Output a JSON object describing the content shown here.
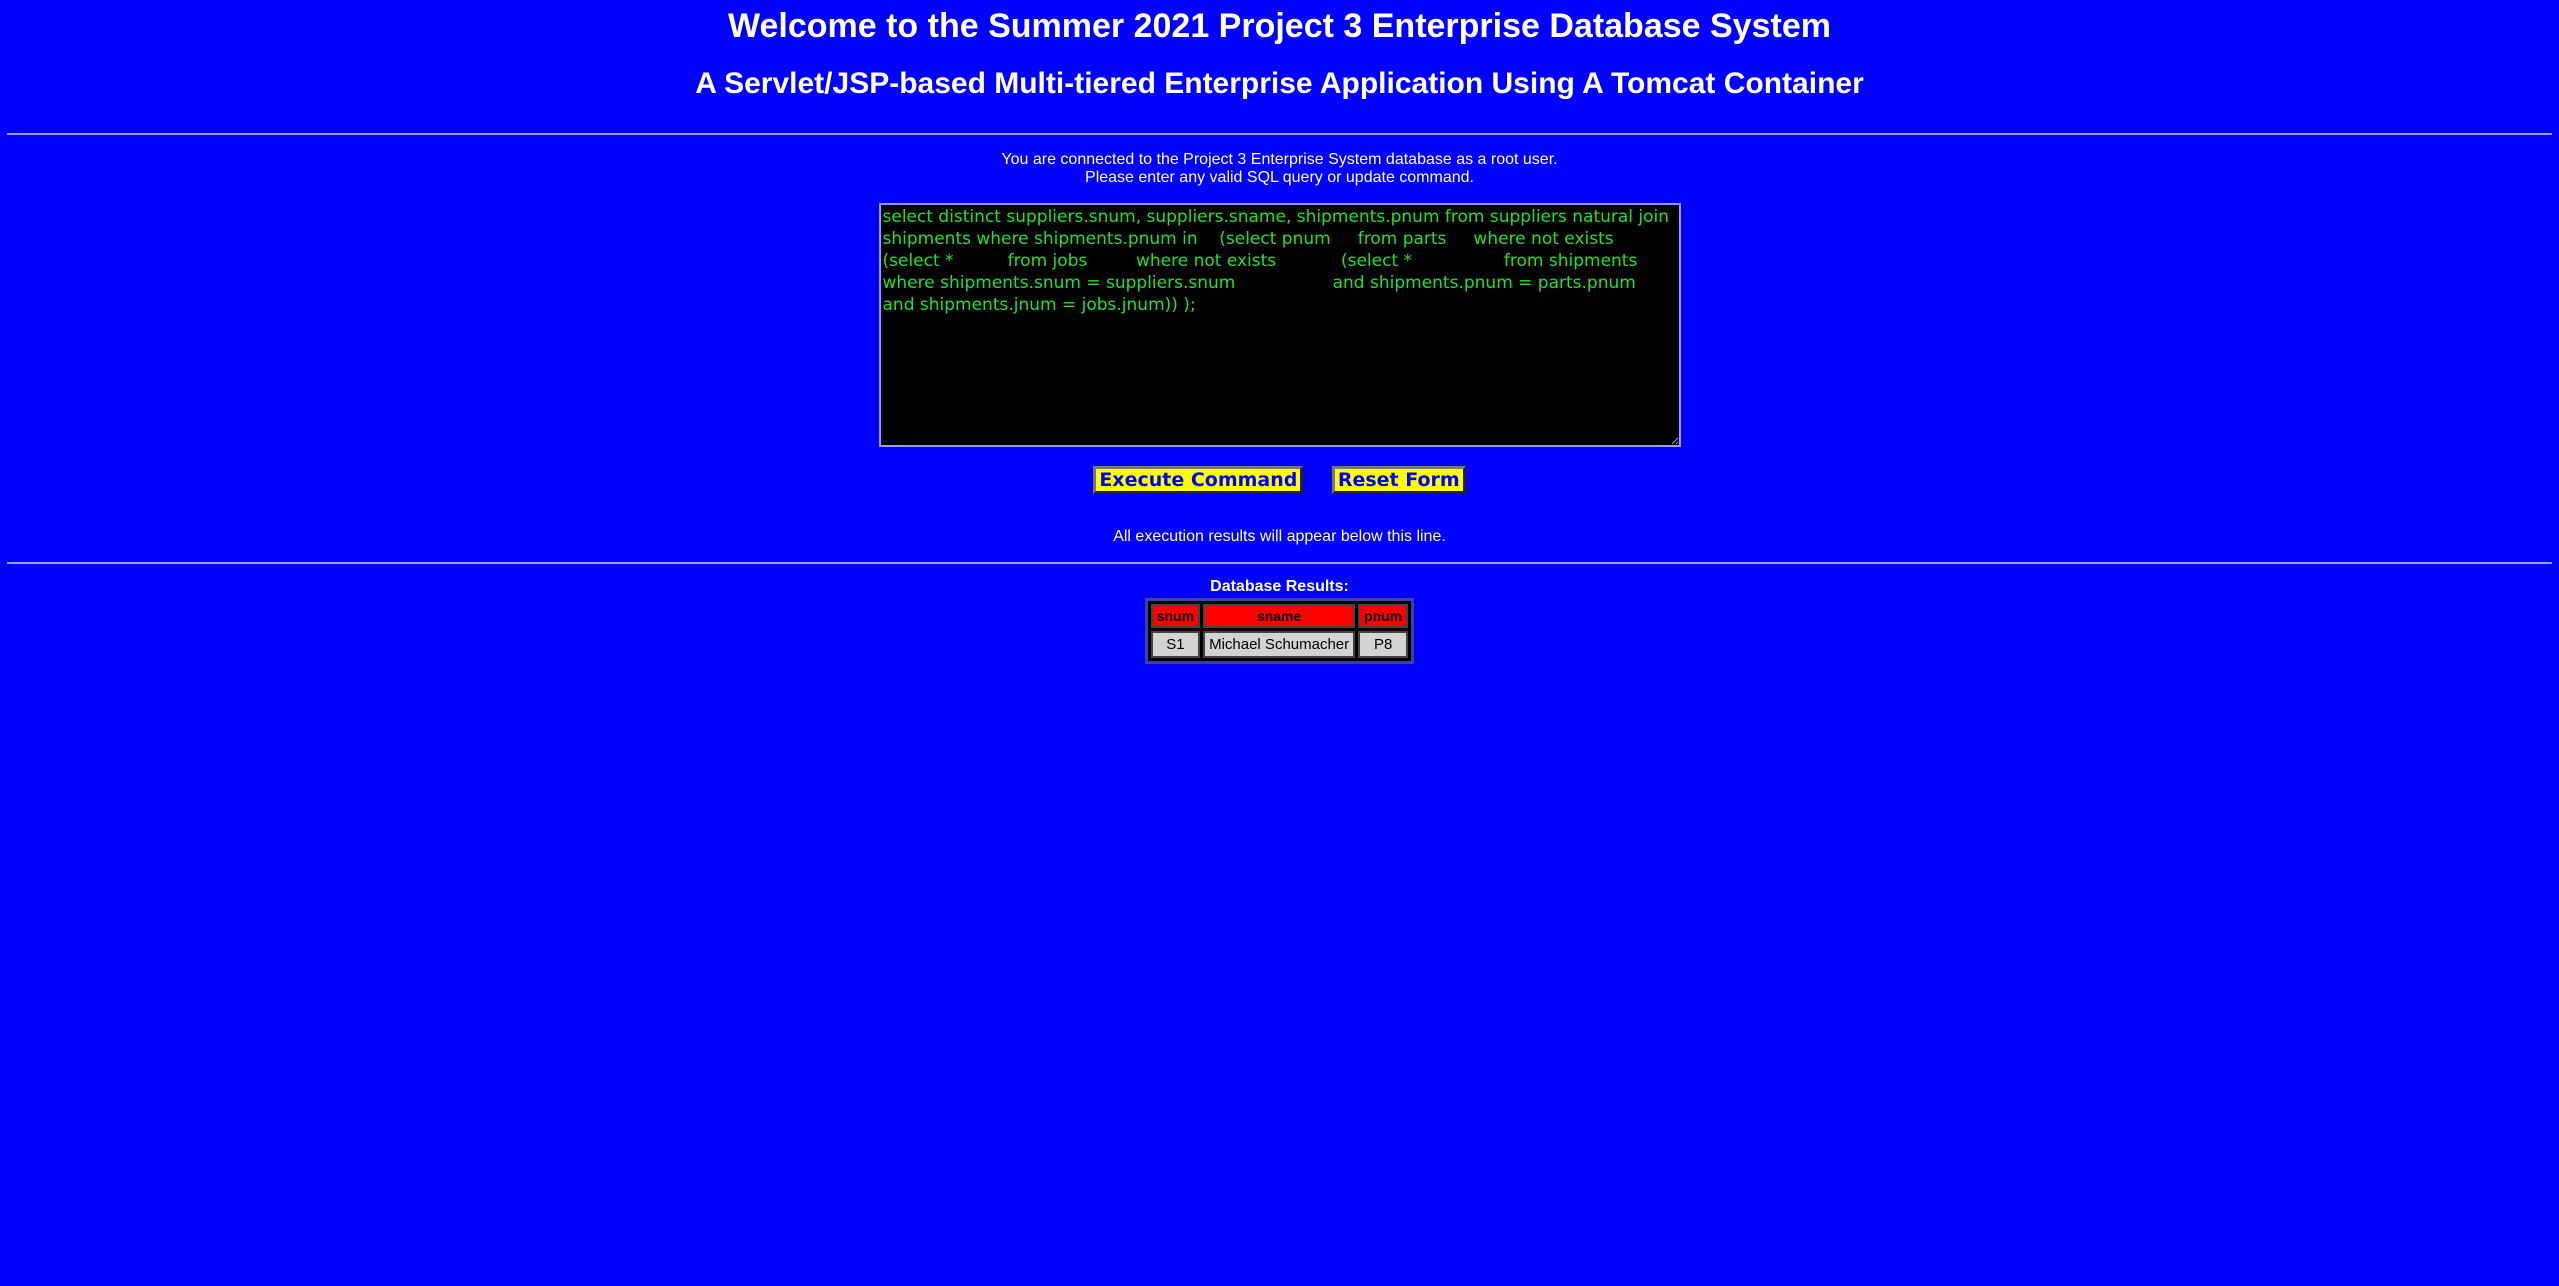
{
  "header": {
    "title": "Welcome to the Summer 2021 Project 3 Enterprise Database System",
    "subtitle": "A Servlet/JSP-based Multi-tiered Enterprise Application Using A Tomcat Container"
  },
  "connection": {
    "line1": "You are connected to the Project 3 Enterprise System database as a root user.",
    "line2": "Please enter any valid SQL query or update command."
  },
  "editor": {
    "value": "select distinct suppliers.snum, suppliers.sname, shipments.pnum from suppliers natural join shipments where shipments.pnum in    (select pnum     from parts     where not exists        (select *          from jobs         where not exists            (select *                 from shipments            where shipments.snum = suppliers.snum                  and shipments.pnum = parts.pnum                 and shipments.jnum = jobs.jnum)) );"
  },
  "buttons": {
    "execute_label": "Execute Command",
    "reset_label": "Reset Form"
  },
  "results_note": "All execution results will appear below this line.",
  "results": {
    "label": "Database Results:",
    "columns": [
      "snum",
      "sname",
      "pnum"
    ],
    "rows": [
      [
        "S1",
        "Michael Schumacher",
        "P8"
      ]
    ]
  },
  "colors": {
    "background": "#0000ff",
    "editor_text": "#22e02a",
    "button_bg": "#ffff00",
    "header_cell": "#ff0000",
    "data_cell": "#d3d3d3"
  }
}
